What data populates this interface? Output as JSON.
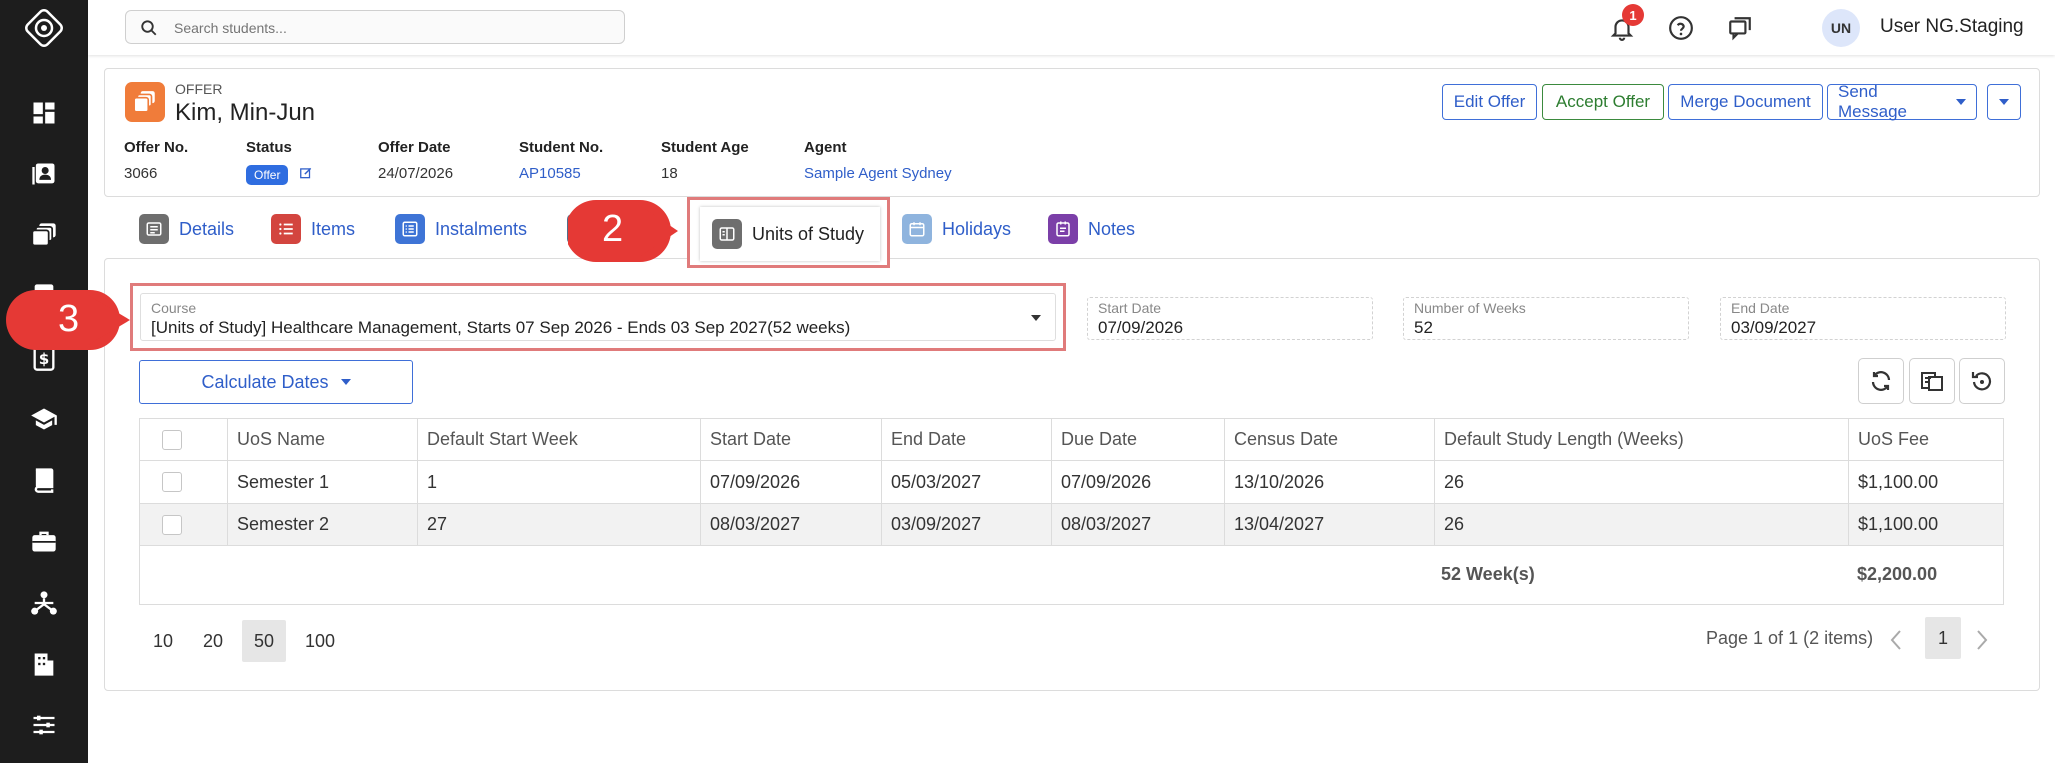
{
  "topbar": {
    "search_placeholder": "Search students...",
    "notification_count": "1",
    "user_initials": "UN",
    "user_name": "User NG.Staging"
  },
  "offer": {
    "label": "OFFER",
    "student_name": "Kim, Min-Jun",
    "actions": {
      "edit": "Edit Offer",
      "accept": "Accept Offer",
      "merge": "Merge Document",
      "send": "Send Message"
    },
    "meta_headers": {
      "offer_no": "Offer No.",
      "status": "Status",
      "offer_date": "Offer Date",
      "student_no": "Student No.",
      "student_age": "Student Age",
      "agent": "Agent"
    },
    "meta_values": {
      "offer_no": "3066",
      "status": "Offer",
      "offer_date": "24/07/2026",
      "student_no": "AP10585",
      "student_age": "18",
      "agent": "Sample Agent Sydney"
    }
  },
  "tabs": {
    "details": "Details",
    "items": "Items",
    "instalments": "Instalments",
    "units_of_study": "Units of Study",
    "holidays": "Holidays",
    "notes": "Notes"
  },
  "callouts": {
    "tab_marker": "2",
    "course_marker": "3"
  },
  "form": {
    "course_label": "Course",
    "course_value": "[Units of Study] Healthcare Management, Starts 07 Sep 2026 - Ends 03 Sep 2027(52 weeks)",
    "start_label": "Start Date",
    "start_value": "07/09/2026",
    "weeks_label": "Number of Weeks",
    "weeks_value": "52",
    "end_label": "End Date",
    "end_value": "03/09/2027",
    "calc_button": "Calculate Dates"
  },
  "table": {
    "headers": {
      "name": "UoS Name",
      "default_start_week": "Default Start Week",
      "start": "Start Date",
      "end": "End Date",
      "due": "Due Date",
      "census": "Census Date",
      "length": "Default Study Length (Weeks)",
      "fee": "UoS Fee"
    },
    "rows": [
      {
        "name": "Semester 1",
        "default_start_week": "1",
        "start": "07/09/2026",
        "end": "05/03/2027",
        "due": "07/09/2026",
        "census": "13/10/2026",
        "length": "26",
        "fee": "$1,100.00"
      },
      {
        "name": "Semester 2",
        "default_start_week": "27",
        "start": "08/03/2027",
        "end": "03/09/2027",
        "due": "08/03/2027",
        "census": "13/04/2027",
        "length": "26",
        "fee": "$1,100.00"
      }
    ],
    "totals": {
      "weeks": "52 Week(s)",
      "fee": "$2,200.00"
    }
  },
  "pager": {
    "sizes": [
      "10",
      "20",
      "50",
      "100"
    ],
    "selected_size": "50",
    "info": "Page 1 of 1 (2 items)",
    "current_page": "1"
  },
  "colors": {
    "sidebar_bg": "#1d1d1d",
    "accent_blue": "#2f5ec9",
    "callout_red": "#e53935",
    "highlight_border": "#e07b7b",
    "offer_icon": "#f07c3a"
  }
}
